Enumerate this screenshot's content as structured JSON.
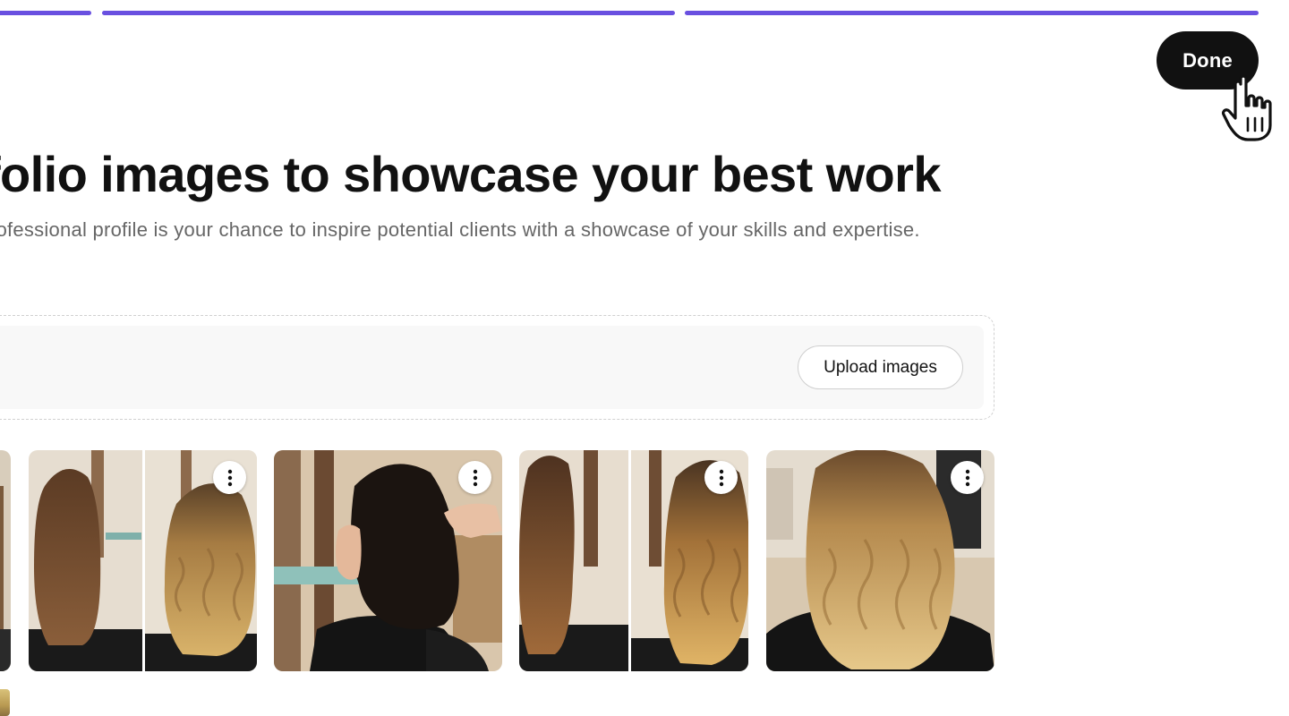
{
  "header": {
    "progress_steps": 3,
    "done_label": "Done"
  },
  "main": {
    "title": "folio images to showcase your best work",
    "subtitle": "rofessional profile is your chance to inspire potential clients with a showcase of your skills and expertise."
  },
  "upload": {
    "button_label": "Upload images"
  },
  "gallery": {
    "images": [
      {
        "icon": "hair-photo"
      },
      {
        "icon": "before-after-balayage-photo"
      },
      {
        "icon": "dark-hair-photo"
      },
      {
        "icon": "before-after-wavy-photo"
      },
      {
        "icon": "wavy-blonde-balayage-photo"
      }
    ],
    "menu_icon": "more-vertical-icon"
  },
  "colors": {
    "accent": "#6950e0",
    "primary_button": "#111111",
    "upload_bg": "#f8f8f8"
  }
}
